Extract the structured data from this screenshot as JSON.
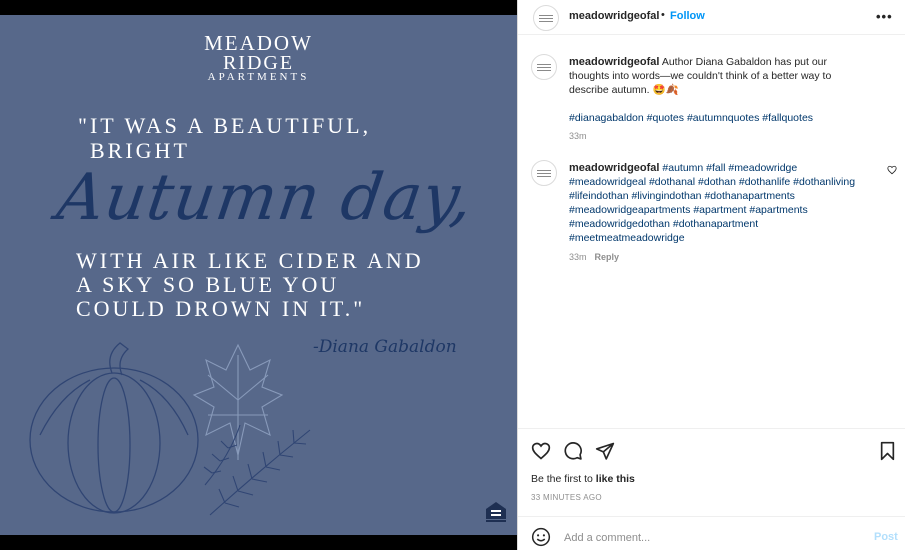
{
  "image": {
    "brand_line1": "MEADOW",
    "brand_line2": "RIDGE",
    "brand_line3": "APARTMENTS",
    "quote_line1": "\"IT WAS A BEAUTIFUL,",
    "quote_line2": "BRIGHT",
    "quote_script": "Autumn day,",
    "quote_line3": "WITH AIR LIKE CIDER AND",
    "quote_line4": "A SKY SO BLUE YOU",
    "quote_line5": "COULD DROWN IN IT.\"",
    "author": "-Diana Gabaldon",
    "background_color": "#57688a",
    "script_color": "#1e3765"
  },
  "header": {
    "username": "meadowridgeofal",
    "separator": "•",
    "follow_label": "Follow",
    "more_icon": "more-horizontal-icon"
  },
  "caption": {
    "username": "meadowridgeofal",
    "text": "Author Diana Gabaldon has put our thoughts into words—we couldn't think of a better way to describe autumn. 🤩🍂",
    "hashtags": "#dianagabaldon #quotes #autumnquotes #fallquotes",
    "time": "33m"
  },
  "comment": {
    "username": "meadowridgeofal",
    "hashtags": "#autumn #fall #meadowridge #meadowridgeal #dothanal #dothan #dothanlife #dothanliving #lifeindothan #livingindothan #dothanapartments #meadowridgeapartments #apartment #apartments #meadowridgedothan #dothanapartment #meetmeatmeadowridge",
    "time": "33m",
    "reply_label": "Reply"
  },
  "actions": {
    "likes_prefix": "Be the first to ",
    "likes_link": "like this",
    "time_ago": "33 MINUTES AGO"
  },
  "add_comment": {
    "placeholder": "Add a comment...",
    "post_label": "Post"
  },
  "colors": {
    "accent": "#0095f6",
    "hashtag": "#00376b",
    "post_disabled": "#b2dffc"
  }
}
